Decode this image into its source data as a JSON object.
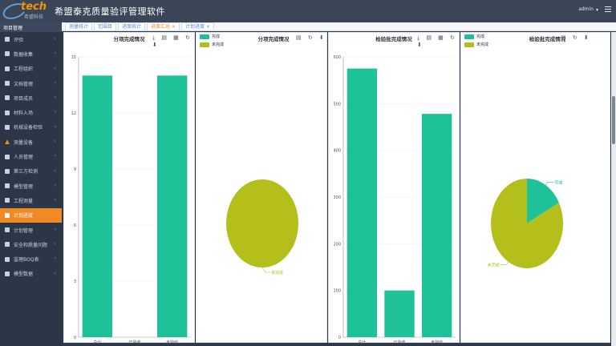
{
  "header": {
    "brand": "tech",
    "brand_sub": "希盟科技",
    "app_title": "希盟泰克质量验评管理软件",
    "user": "admin"
  },
  "sidebar": {
    "title": "项目管理",
    "items": [
      {
        "label": "评验",
        "icon": "gear-icon"
      },
      {
        "label": "数据收集",
        "icon": "gear-icon"
      },
      {
        "label": "工程组织",
        "icon": "hierarchy-icon"
      },
      {
        "label": "文档管理",
        "icon": "document-icon"
      },
      {
        "label": "项目成员",
        "icon": "user-icon"
      },
      {
        "label": "材料入场",
        "icon": "box-icon"
      },
      {
        "label": "机械设备检验",
        "icon": "machine-icon"
      },
      {
        "label": "测量设备",
        "icon": "warning-icon"
      },
      {
        "label": "人员管理",
        "icon": "user-icon"
      },
      {
        "label": "第三方检测",
        "icon": "globe-icon"
      },
      {
        "label": "模型管理",
        "icon": "cube-icon"
      },
      {
        "label": "工程测量",
        "icon": "chart-icon"
      },
      {
        "label": "计划进度",
        "icon": "gear-icon"
      },
      {
        "label": "计划管理",
        "icon": "calendar-icon"
      },
      {
        "label": "安全和质量问题",
        "icon": "shield-icon"
      },
      {
        "label": "监理BOQ表",
        "icon": "table-icon"
      },
      {
        "label": "模型数据",
        "icon": "list-icon"
      }
    ],
    "active_index": 12
  },
  "tabs": [
    {
      "label": "测量统计"
    },
    {
      "label": "范围目"
    },
    {
      "label": "进度统计"
    },
    {
      "label": "进度汇总"
    },
    {
      "label": "计划进度"
    }
  ],
  "panels": {
    "p1_title": "分项完成情况",
    "p2_title": "分项完成情况",
    "p3_title": "检验批完成情况",
    "p4_title": "检验批完成情况",
    "legend_done": "完成",
    "legend_undone": "未完成",
    "tool_icons": "⤓ ▤ ▦ ↻ ⬇"
  },
  "colors": {
    "green": "#1ec198",
    "olive": "#b5bf1b",
    "accent": "#f08a24"
  },
  "chart_data": [
    {
      "type": "bar",
      "title": "分项完成情况",
      "categories": [
        "总计",
        "已验收",
        "未验收"
      ],
      "values": [
        14,
        0,
        14
      ],
      "ylim": [
        0,
        15
      ],
      "yticks": [
        0,
        3,
        6,
        9,
        12,
        15
      ]
    },
    {
      "type": "pie",
      "title": "分项完成情况",
      "labels": [
        "完成",
        "未完成"
      ],
      "values": [
        0,
        14
      ],
      "legend": "top-left"
    },
    {
      "type": "bar",
      "title": "检验批完成情况",
      "categories": [
        "总计",
        "已验收",
        "未验收"
      ],
      "values": [
        575,
        100,
        478
      ],
      "ylim": [
        0,
        600
      ],
      "yticks": [
        0,
        100,
        200,
        300,
        400,
        500,
        600
      ]
    },
    {
      "type": "pie",
      "title": "检验批完成情况",
      "labels": [
        "完成",
        "未完成"
      ],
      "values": [
        100,
        478
      ],
      "legend": "top-left"
    }
  ]
}
